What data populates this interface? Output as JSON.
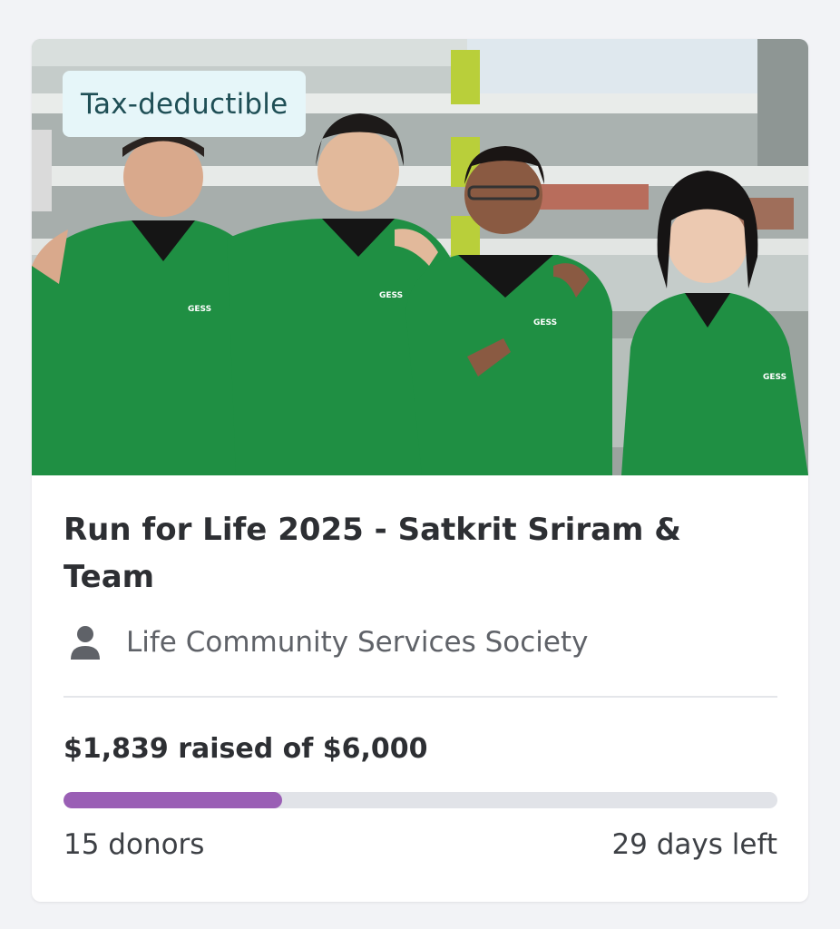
{
  "badge": {
    "label": "Tax-deductible"
  },
  "campaign": {
    "title": "Run for Life 2025 - Satkrit Sriram & Team",
    "organizer": "Life Community Services Society",
    "organizer_icon": "person-icon"
  },
  "photo": {
    "shirt_logo_text": "GESS"
  },
  "fundraising": {
    "raised_text": "$1,839 raised of $6,000",
    "raised": 1839,
    "goal": 6000,
    "progress_fraction": 0.3065,
    "donors_text": "15 donors",
    "days_left_text": "29 days left"
  },
  "colors": {
    "progress_fill": "#9a5fb5",
    "progress_track": "#e1e3e8",
    "badge_bg": "#e6f6f9",
    "badge_text": "#1f4f56",
    "shirt_green": "#1f8f43"
  }
}
